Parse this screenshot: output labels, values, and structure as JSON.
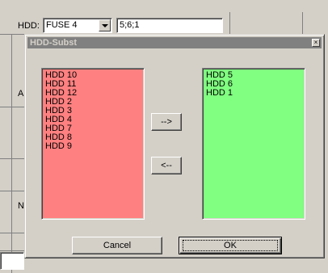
{
  "background": {
    "hdd_label": "HDD:",
    "combo_value": "FUSE 4",
    "text_value": "5;6;1",
    "side_letters": [
      "A",
      "N",
      ")"
    ]
  },
  "dialog": {
    "title": "HDD-Subst",
    "close_glyph": "×",
    "left_list": [
      "HDD 10",
      "HDD 11",
      "HDD 12",
      "HDD 2",
      "HDD 3",
      "HDD 4",
      "HDD 7",
      "HDD 8",
      "HDD 9"
    ],
    "right_list": [
      "HDD 5",
      "HDD 6",
      "HDD 1"
    ],
    "move_right_label": "-->",
    "move_left_label": "<--",
    "cancel_label": "Cancel",
    "ok_label": "OK"
  },
  "colors": {
    "left_list_bg": "#ff8080",
    "right_list_bg": "#80ff80",
    "titlebar_bg": "#808080"
  }
}
